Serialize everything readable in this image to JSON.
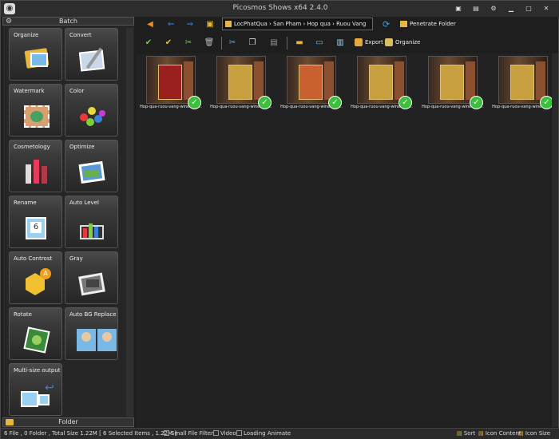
{
  "window": {
    "title": "Picosmos Shows x64 2.4.0"
  },
  "left_panel": {
    "header": "Batch",
    "footer": "Folder",
    "tools": [
      {
        "label": "Organize",
        "icon": "organize-folder-icon"
      },
      {
        "label": "Convert",
        "icon": "convert-icon"
      },
      {
        "label": "Watermark",
        "icon": "watermark-icon"
      },
      {
        "label": "Color",
        "icon": "color-palette-icon"
      },
      {
        "label": "Cosmetology",
        "icon": "cosmetics-icon"
      },
      {
        "label": "Optimize",
        "icon": "optimize-photo-icon"
      },
      {
        "label": "Rename",
        "icon": "rename-icon"
      },
      {
        "label": "Auto Level",
        "icon": "auto-level-icon"
      },
      {
        "label": "Auto Controst",
        "icon": "auto-contrast-icon"
      },
      {
        "label": "Gray",
        "icon": "gray-photo-icon"
      },
      {
        "label": "Rotate",
        "icon": "rotate-icon"
      },
      {
        "label": "Auto BG Replace",
        "icon": "bg-replace-icon"
      },
      {
        "label": "Multi-size output",
        "icon": "multi-size-icon"
      }
    ]
  },
  "nav": {
    "path": "LocPhatQua › San Pham › Hop qua › Ruou Vang",
    "penetrate_label": "Penetrate Folder"
  },
  "toolbar": {
    "export_label": "Export",
    "organize_label": "Organize"
  },
  "thumbnails": [
    {
      "caption": "Hop-qua-ruou-vang-wine-box..."
    },
    {
      "caption": "Hop-qua-ruou-vang-wine-box..."
    },
    {
      "caption": "Hop-qua-ruou-vang-wine-box..."
    },
    {
      "caption": "Hop-qua-ruou-vang-wine-box..."
    },
    {
      "caption": "Hop-qua-ruou-vang-wine-box..."
    },
    {
      "caption": "Hop-qua-ruou-vang-wine-box..."
    }
  ],
  "status": {
    "summary": "6 File , 0 Folder , Total Size 1.22M [ 6 Selected Items , 1.22M ]",
    "small_file_filter": "Small File Filter",
    "video": "Video",
    "loading_animate": "Loading Animate",
    "sort": "Sort",
    "icon_content": "Icon Content",
    "icon_size": "Icon Size"
  }
}
